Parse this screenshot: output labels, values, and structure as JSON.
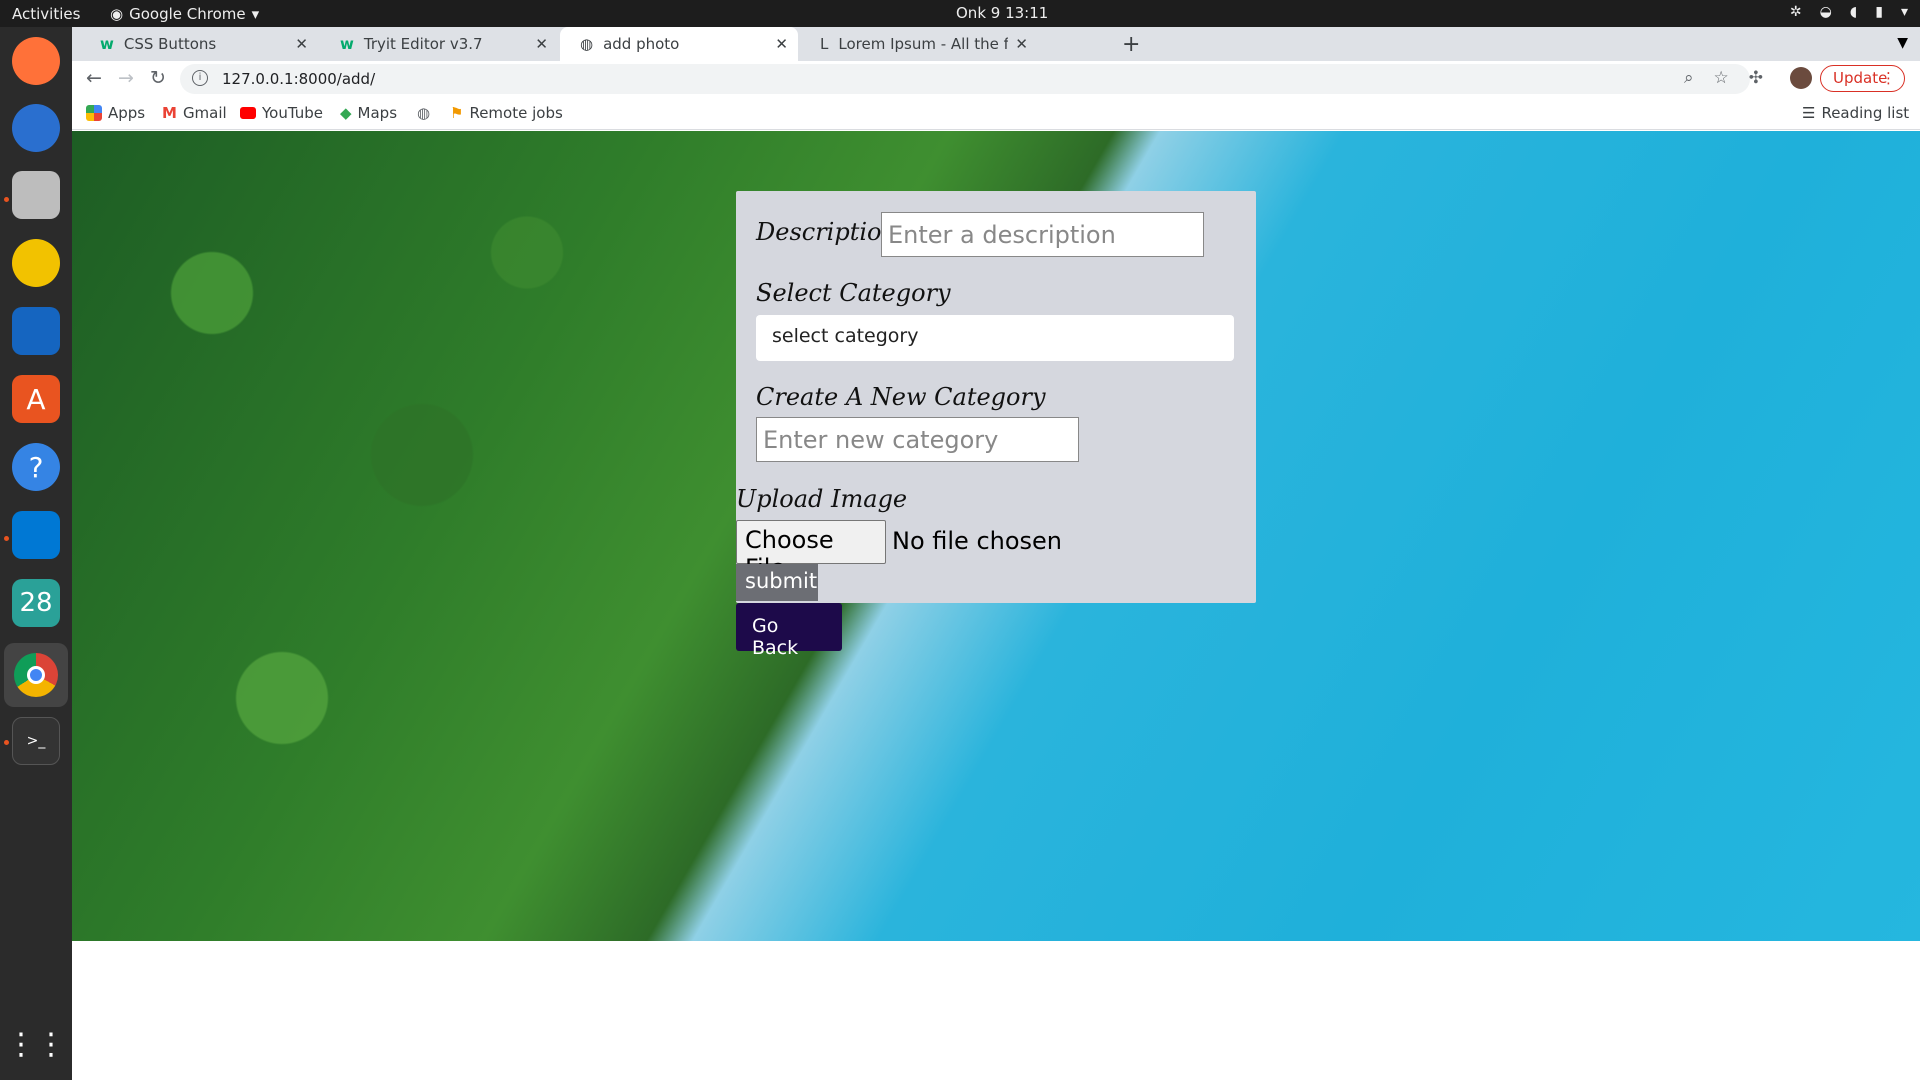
{
  "system": {
    "activities": "Activities",
    "app_name": "Google Chrome",
    "clock": "Onk 9  13:11"
  },
  "tabs": [
    {
      "label": "CSS Buttons",
      "favicon": "w3schools-icon"
    },
    {
      "label": "Tryit Editor v3.7",
      "favicon": "w3schools-icon"
    },
    {
      "label": "add photo",
      "favicon": "globe-icon",
      "active": true
    },
    {
      "label": "Lorem Ipsum - All the fact",
      "favicon": "lorem-icon"
    }
  ],
  "toolbar": {
    "url": "127.0.0.1:8000/add/",
    "update_label": "Update"
  },
  "bookmarks": [
    {
      "label": "Apps",
      "color": "#4285f4"
    },
    {
      "label": "Gmail",
      "color": "#ea4335"
    },
    {
      "label": "YouTube",
      "color": "#ff0000"
    },
    {
      "label": "Maps",
      "color": "#34a853"
    },
    {
      "label": "",
      "color": "#5f6368"
    },
    {
      "label": "Remote jobs",
      "color": "#f29900"
    }
  ],
  "reading_list": "Reading list",
  "form": {
    "description_label": "Description",
    "description_placeholder": "Enter a description",
    "category_label": "Select Category",
    "category_value": "select category",
    "new_category_label": "Create A New Category",
    "new_category_placeholder": "Enter new category",
    "upload_label": "Upload Image",
    "choose_file": "Choose File",
    "no_file": "No file chosen",
    "submit": "submit",
    "go_back": "Go Back"
  },
  "dock": [
    {
      "name": "firefox-icon",
      "color": "#ff7139"
    },
    {
      "name": "thunderbird-icon",
      "color": "#2a6fcf"
    },
    {
      "name": "files-icon",
      "color": "#9a9a9a"
    },
    {
      "name": "rhythmbox-icon",
      "color": "#f2c200"
    },
    {
      "name": "writer-icon",
      "color": "#1565c0"
    },
    {
      "name": "software-icon",
      "color": "#e95420"
    },
    {
      "name": "help-icon",
      "color": "#3584e4"
    },
    {
      "name": "vscode-icon",
      "color": "#0078d4"
    },
    {
      "name": "calendar-icon",
      "color": "#2aa198"
    },
    {
      "name": "chrome-icon",
      "color": "#db4437"
    },
    {
      "name": "terminal-icon",
      "color": "#333333"
    }
  ]
}
